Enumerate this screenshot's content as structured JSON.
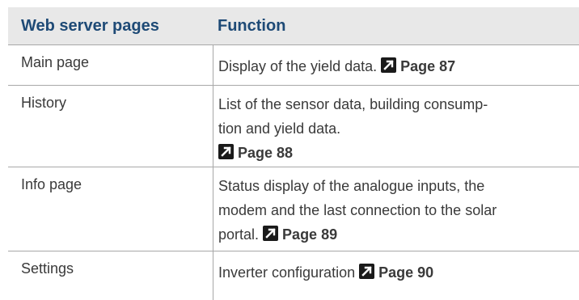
{
  "header": {
    "col1": "Web server pages",
    "col2": "Function"
  },
  "rows": [
    {
      "page": "Main page",
      "function_text": "Display of the yield data.",
      "ref": "Page 87"
    },
    {
      "page": "History",
      "function_line1": "List of the sensor data, building consump-",
      "function_line2": "tion and yield data.",
      "ref": "Page 88"
    },
    {
      "page": "Info page",
      "function_line1": "Status display of the analogue inputs, the",
      "function_line2": "modem and the last connection to the solar",
      "function_line3": "portal.",
      "ref": "Page 89"
    },
    {
      "page": "Settings",
      "function_text": "Inverter configuration",
      "ref": "Page 90"
    }
  ]
}
